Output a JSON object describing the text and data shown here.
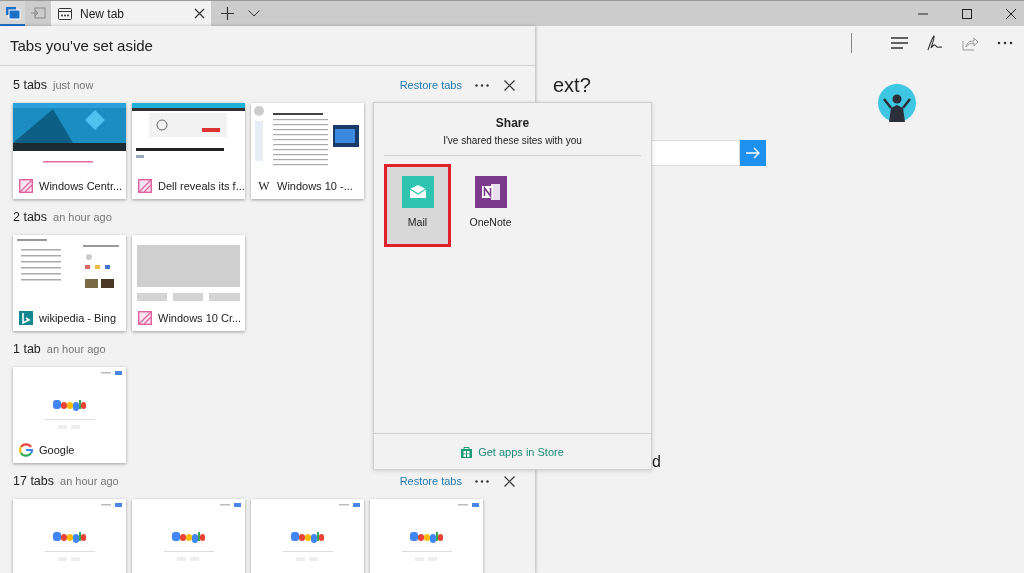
{
  "tab_bar": {
    "side_buttons": [
      {
        "kind": "tabs-aside",
        "selected": true
      },
      {
        "kind": "set-aside",
        "selected": false
      }
    ],
    "tabs": [
      {
        "title": "New tab",
        "selected": true
      }
    ]
  },
  "page": {
    "heading_fragment": "ext?",
    "fragment": "d"
  },
  "panel": {
    "title": "Tabs you've set aside",
    "groups": [
      {
        "count": "5 tabs",
        "time": "just now",
        "restore": "Restore tabs",
        "cards": [
          {
            "kind": "windows-central",
            "favicon": {
              "kind": "windows-central"
            },
            "title": "Windows Centr..."
          },
          {
            "kind": "dell",
            "favicon": {
              "kind": "windows-central"
            },
            "title": "Dell reveals its f..."
          },
          {
            "kind": "wiki",
            "favicon": {
              "kind": "letter",
              "text": "W"
            },
            "title": "Windows 10 -..."
          }
        ]
      },
      {
        "count": "2 tabs",
        "time": "an hour ago",
        "cards": [
          {
            "kind": "bing",
            "favicon": {
              "kind": "bing"
            },
            "title": "wikipedia - Bing"
          },
          {
            "kind": "placeholder",
            "favicon": {
              "kind": "windows-central"
            },
            "title": "Windows 10 Cr..."
          }
        ]
      },
      {
        "count": "1 tab",
        "time": "an hour ago",
        "cards": [
          {
            "kind": "google",
            "favicon": {
              "kind": "google"
            },
            "title": "Google"
          }
        ]
      },
      {
        "count": "17 tabs",
        "time": "an hour ago",
        "restore": "Restore tabs",
        "cards": [
          {
            "kind": "google"
          },
          {
            "kind": "google"
          },
          {
            "kind": "google"
          },
          {
            "kind": "google"
          }
        ]
      }
    ]
  },
  "share": {
    "title": "Share",
    "subtitle": "I've shared these sites with you",
    "apps": [
      {
        "kind": "mail",
        "name": "Mail",
        "selected": true
      },
      {
        "kind": "onenote",
        "name": "OneNote",
        "selected": false
      }
    ],
    "store_link": "Get apps in Store"
  }
}
